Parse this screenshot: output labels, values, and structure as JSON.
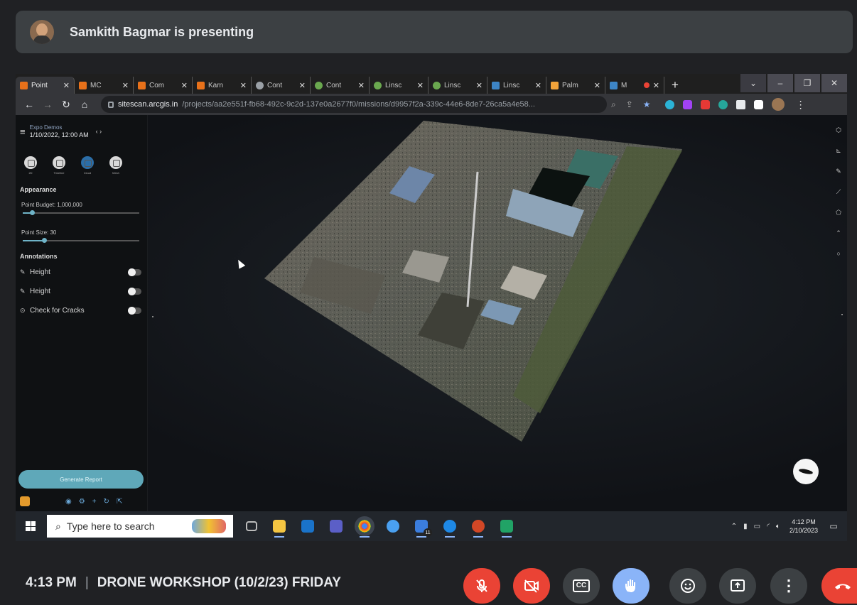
{
  "presenter_banner": {
    "text": "Samkith Bagmar is presenting"
  },
  "browser": {
    "tabs": [
      {
        "label": "Point",
        "color": "#e8711a",
        "active": true
      },
      {
        "label": "MC",
        "color": "#e8711a"
      },
      {
        "label": "Com",
        "color": "#e8711a"
      },
      {
        "label": "Karn",
        "color": "#e8711a"
      },
      {
        "label": "Cont",
        "color": "#9aa0a6"
      },
      {
        "label": "Cont",
        "color": "#6aa84f"
      },
      {
        "label": "Linsc",
        "color": "#6aa84f"
      },
      {
        "label": "Linsc",
        "color": "#6aa84f"
      },
      {
        "label": "Linsc",
        "color": "#3d85c6"
      },
      {
        "label": "Palm",
        "color": "#f1a33a"
      },
      {
        "label": "M",
        "color": "#3d85c6"
      }
    ],
    "new_tab": "+",
    "window_controls": [
      "⌄",
      "–",
      "❐",
      "✕"
    ],
    "url_host": "sitescan.arcgis.in",
    "url_path": "/projects/aa2e551f-fb68-492c-9c2d-137e0a2677f0/missions/d9957f2a-339c-44e6-8de7-26ca5a4e58..."
  },
  "sidebar": {
    "project": "Expo Demos",
    "date": "1/10/2022, 12:00 AM",
    "modes": [
      "2D",
      "Timeline",
      "Cloud",
      "Mesh"
    ],
    "appearance_title": "Appearance",
    "point_budget_label": "Point Budget: 1,000,000",
    "point_budget_level": 0.08,
    "point_size_label": "Point Size: 30",
    "point_size_level": 0.18,
    "annotations_title": "Annotations",
    "annotations": [
      {
        "icon": "✎",
        "label": "Height"
      },
      {
        "icon": "✎",
        "label": "Height"
      },
      {
        "icon": "⊙",
        "label": "Check for Cracks"
      }
    ],
    "generate_report": "Generate Report"
  },
  "taskbar": {
    "search_placeholder": "Type here to search",
    "chrome_badge": "11",
    "time": "4:12 PM",
    "date": "2/10/2023"
  },
  "meet": {
    "time": "4:13 PM",
    "separator": "|",
    "meeting_title": "DRONE WORKSHOP (10/2/23) FRIDAY"
  },
  "colors": {
    "meet_red": "#ea4335",
    "meet_blue": "#8ab4f8",
    "meet_gray": "#3c4043",
    "accent_teal": "#5fa8b9"
  }
}
